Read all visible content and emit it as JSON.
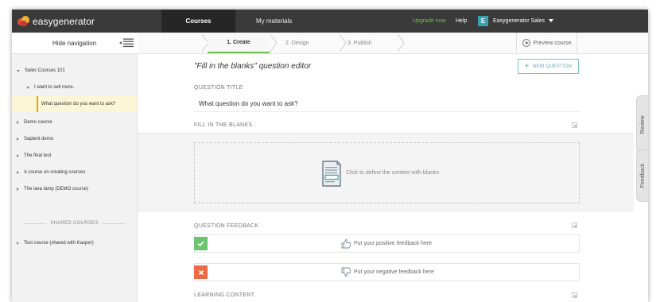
{
  "topbar": {
    "logo_text": "easygenerator",
    "nav": {
      "courses": "Courses",
      "materials": "My materials"
    },
    "upgrade": "Upgrade now",
    "help": "Help",
    "user_initial": "E",
    "user_name": "Easygenerator Sales"
  },
  "sidebar": {
    "hide_label": "Hide navigation",
    "items": [
      {
        "label": "Sales Courses 101",
        "expanded": true
      },
      {
        "label": "I want to sell more.",
        "expanded": true
      },
      {
        "label": "What question do you want to ask?",
        "selected": true
      },
      {
        "label": "Demo course"
      },
      {
        "label": "Sapient demo"
      },
      {
        "label": "The final test"
      },
      {
        "label": "A course on creating courses"
      },
      {
        "label": "The lava lamp (DEMO course)"
      }
    ],
    "shared_header": "SHARED COURSES",
    "shared_items": [
      {
        "label": "Test course (shared with Kasper)"
      }
    ]
  },
  "steps": {
    "create": "1. Create",
    "design": "2. Design",
    "publish": "3. Publish",
    "preview": "Preview course"
  },
  "editor": {
    "title": "\"Fill in the blanks\" question editor",
    "new_question": "NEW QUESTION",
    "question_title_label": "QUESTION TITLE",
    "question_title_value": "What question do you want to ask?",
    "blanks_label": "FILL IN THE BLANKS",
    "blanks_placeholder": "Click to define the content with blanks",
    "feedback_label": "QUESTION FEEDBACK",
    "positive_feedback": "Put your positive feedback here",
    "negative_feedback": "Put your negative feedback here",
    "learning_content_label": "LEARNING CONTENT"
  },
  "side_tabs": {
    "review": "Review",
    "feedback": "Feedback"
  },
  "colors": {
    "topbar": "#3a3a3a",
    "accent_green": "#6cc04a",
    "accent_teal": "#3aa1b0",
    "selected_bar": "#e6a21b",
    "positive": "#6cc46f",
    "negative": "#ec6b46"
  },
  "icons": {
    "logo": "easygenerator-logo-icon",
    "hide_nav": "list-collapse-icon",
    "preview": "play-circle-icon",
    "document": "document-blanks-icon",
    "thumbs_up": "thumbs-up-icon",
    "thumbs_down": "thumbs-down-icon",
    "check": "check-icon",
    "close": "close-icon"
  }
}
